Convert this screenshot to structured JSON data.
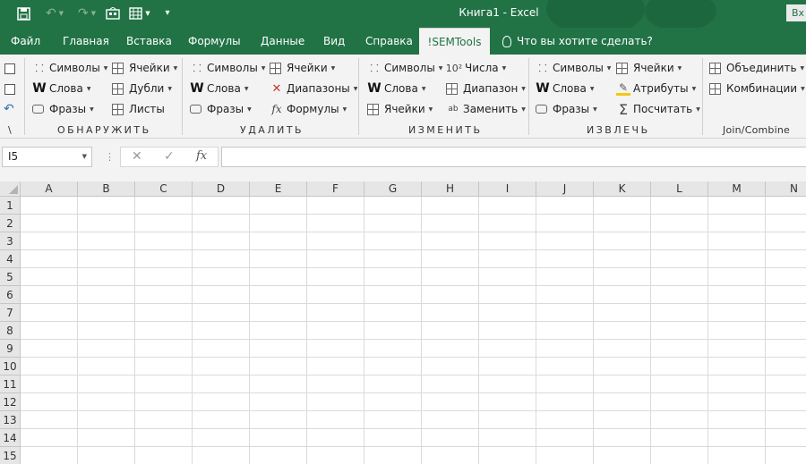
{
  "titlebar": {
    "title": "Книга1  -  Excel",
    "signin": "Вх",
    "quick_access": [
      {
        "name": "save-icon"
      },
      {
        "name": "undo-icon"
      },
      {
        "name": "redo-icon"
      },
      {
        "name": "semtools-icon"
      },
      {
        "name": "table-icon"
      },
      {
        "name": "customize-icon"
      }
    ]
  },
  "tabs": [
    "Файл",
    "Главная",
    "Вставка",
    "Формулы",
    "Данные",
    "Вид",
    "Справка",
    "!SEMTools"
  ],
  "active_tab": "!SEMTools",
  "tellme": "Что вы хотите сделать?",
  "ribbon": {
    "groups": [
      {
        "label": "ОБНАРУЖИТЬ",
        "col1": [
          "Символы",
          "Слова",
          "Фразы"
        ],
        "col2": [
          "Ячейки",
          "Дубли",
          "Листы"
        ]
      },
      {
        "label": "УДАЛИТЬ",
        "col1": [
          "Символы",
          "Слова",
          "Фразы"
        ],
        "col2": [
          "Ячейки",
          "Диапазоны",
          "Формулы"
        ]
      },
      {
        "label": "ИЗМЕНИТЬ",
        "col1": [
          "Символы",
          "Слова",
          "Ячейки"
        ],
        "col2": [
          "Числа",
          "Диапазон",
          "Заменить"
        ]
      },
      {
        "label": "ИЗВЛЕЧЬ",
        "col1": [
          "Символы",
          "Слова",
          "Фразы"
        ],
        "col2": [
          "Ячейки",
          "Атрибуты",
          "Посчитать"
        ]
      },
      {
        "label": "Join/Combine",
        "col1": [
          "Объединить",
          "Комбинации"
        ],
        "col2": []
      }
    ],
    "left_label": "\\"
  },
  "formula_bar": {
    "name_box": "I5",
    "cancel": "✕",
    "enter": "✓",
    "fx": "fx",
    "value": ""
  },
  "grid": {
    "columns": [
      "A",
      "B",
      "C",
      "D",
      "E",
      "F",
      "G",
      "H",
      "I",
      "J",
      "K",
      "L",
      "M",
      "N"
    ],
    "rows": [
      "1",
      "2",
      "3",
      "4",
      "5",
      "6",
      "7",
      "8",
      "9",
      "10",
      "11",
      "12",
      "13",
      "14",
      "15"
    ]
  },
  "colors": {
    "brand": "#217346",
    "ribbon_bg": "#f3f3f3",
    "header_bg": "#e6e6e6",
    "gridline": "#dadada"
  }
}
